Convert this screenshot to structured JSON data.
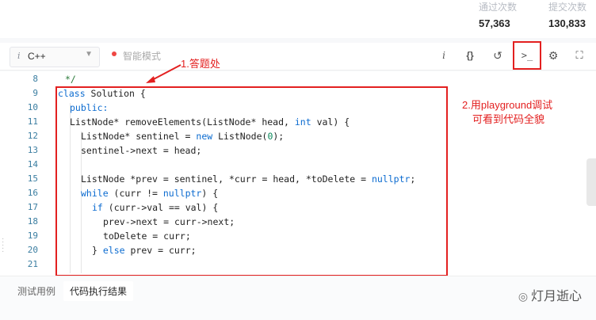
{
  "stats": [
    {
      "label": "通过次数",
      "value": "57,363"
    },
    {
      "label": "提交次数",
      "value": "130,833"
    }
  ],
  "toolbar": {
    "language": "C++",
    "smart_mode": "智能模式",
    "icons": [
      "info-icon",
      "braces-icon",
      "reset-icon",
      "terminal-icon",
      "settings-icon",
      "fullscreen-icon"
    ]
  },
  "annotations": {
    "a1": "1.答题处",
    "a2_line1": "2.用playground调试",
    "a2_line2": "可看到代码全貌"
  },
  "code_lines": [
    {
      "n": "8"
    },
    {
      "n": "9"
    },
    {
      "n": "10"
    },
    {
      "n": "11"
    },
    {
      "n": "12"
    },
    {
      "n": "13"
    },
    {
      "n": "14"
    },
    {
      "n": "15"
    },
    {
      "n": "16"
    },
    {
      "n": "17"
    },
    {
      "n": "18"
    },
    {
      "n": "19"
    },
    {
      "n": "20"
    },
    {
      "n": "21"
    }
  ],
  "code": {
    "l8": "*/",
    "l9a": "class",
    "l9b": " Solution {",
    "l10": "public:",
    "l11a": "ListNode* removeElements(ListNode* head, ",
    "l11b": "int",
    "l11c": " val) {",
    "l12a": "ListNode* sentinel = ",
    "l12b": "new",
    "l12c": " ListNode(",
    "l12d": "0",
    "l12e": ");",
    "l13": "sentinel->next = head;",
    "l15a": "ListNode *prev = sentinel, *curr = head, *toDelete = ",
    "l15b": "nullptr",
    "l15c": ";",
    "l16a": "while",
    "l16b": " (curr != ",
    "l16c": "nullptr",
    "l16d": ") {",
    "l17a": "if",
    "l17b": " (curr->val == val) {",
    "l18": "prev->next = curr->next;",
    "l19": "toDelete = curr;",
    "l20a": "} ",
    "l20b": "else",
    "l20c": " prev = curr;"
  },
  "bottom_tabs": [
    "测试用例",
    "代码执行结果"
  ],
  "watermark": "灯月逝心"
}
